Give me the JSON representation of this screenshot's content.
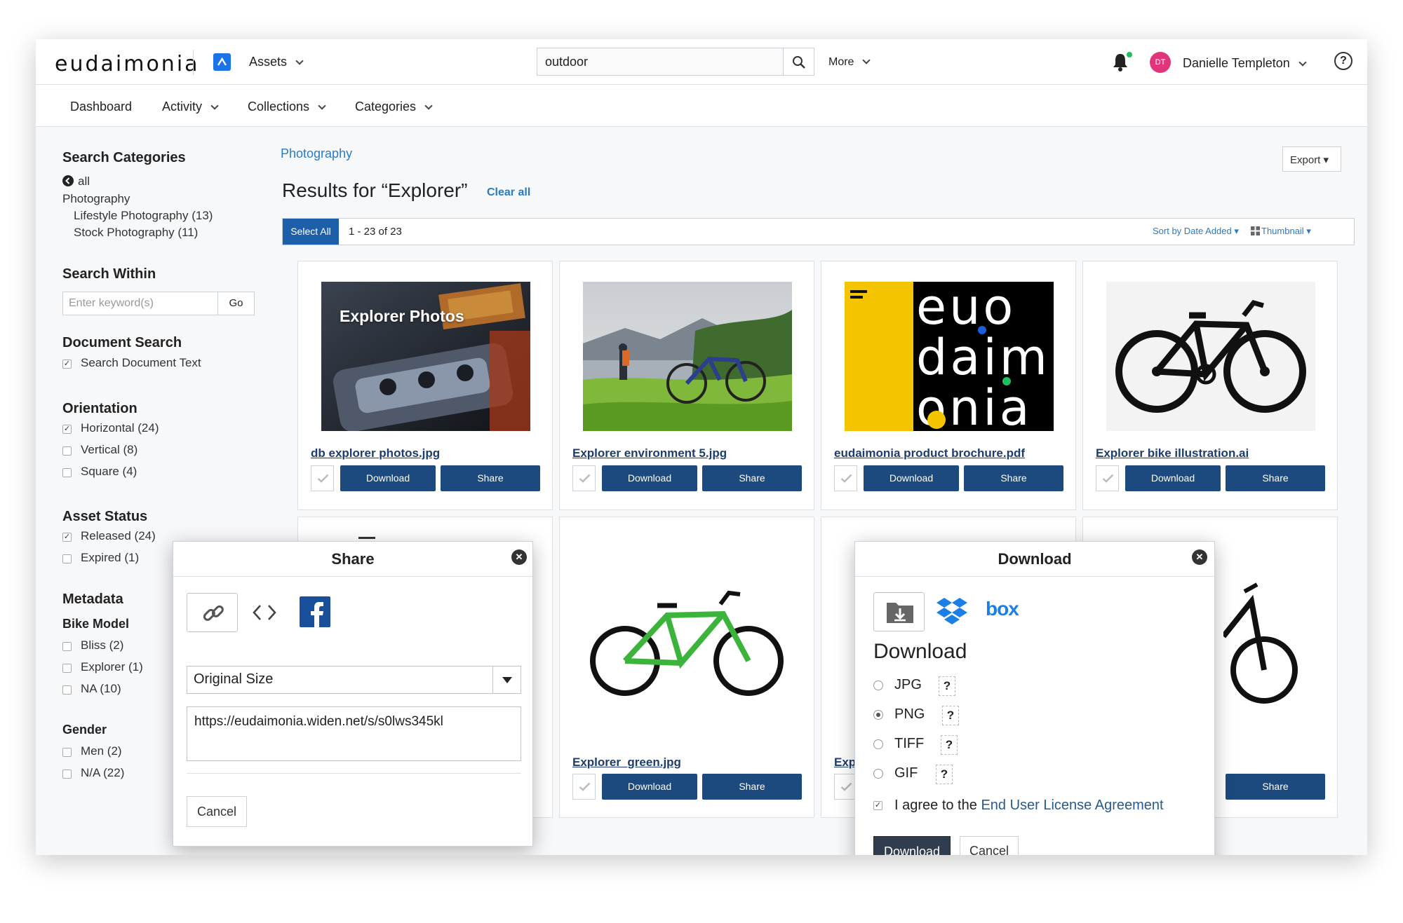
{
  "topbar": {
    "logo": "eudaimonia",
    "app_label": "Assets",
    "search_value": "outdoor",
    "more_label": "More",
    "user_initials": "DT",
    "user_name": "Danielle Templeton",
    "help_label": "?"
  },
  "nav": {
    "items": [
      "Dashboard",
      "Activity",
      "Collections",
      "Categories"
    ]
  },
  "sidebar": {
    "search_categories": {
      "heading": "Search Categories",
      "all": "all",
      "parent": "Photography",
      "children": [
        "Lifestyle Photography (13)",
        "Stock Photography (11)"
      ]
    },
    "search_within": {
      "heading": "Search Within",
      "placeholder": "Enter keyword(s)",
      "go": "Go"
    },
    "document_search": {
      "heading": "Document Search",
      "option": "Search Document Text"
    },
    "orientation": {
      "heading": "Orientation",
      "options": [
        "Horizontal (24)",
        "Vertical (8)",
        "Square (4)"
      ]
    },
    "asset_status": {
      "heading": "Asset Status",
      "options": [
        "Released (24)",
        "Expired (1)"
      ]
    },
    "metadata": {
      "heading": "Metadata",
      "bike_model": {
        "heading": "Bike Model",
        "options": [
          "Bliss (2)",
          "Explorer (1)",
          "NA (10)"
        ]
      },
      "gender": {
        "heading": "Gender",
        "options": [
          "Men (2)",
          "N/A (22)"
        ]
      }
    }
  },
  "main": {
    "breadcrumb": "Photography",
    "export_label": "Export",
    "results_title": "Results for “Explorer”",
    "clear_all": "Clear all",
    "select_all": "Select All",
    "count": "1 - 23 of 23",
    "sort_label": "Sort by Date Added",
    "view_label": "Thumbnail",
    "cards": [
      {
        "title": "db explorer photos.jpg",
        "overlay": "Explorer Photos",
        "download": "Download",
        "share": "Share"
      },
      {
        "title": "Explorer environment 5.jpg",
        "download": "Download",
        "share": "Share"
      },
      {
        "title": "eudaimonia product brochure.pdf",
        "brochure_text": [
          "euo",
          "daim",
          "onia"
        ],
        "download": "Download",
        "share": "Share"
      },
      {
        "title": "Explorer bike illustration.ai",
        "download": "Download",
        "share": "Share"
      },
      {
        "title": "Explorer_green.jpg",
        "download": "Download",
        "share": "Share"
      },
      {
        "title": "Expl",
        "share": "Share"
      }
    ]
  },
  "share_modal": {
    "title": "Share",
    "size_value": "Original Size",
    "link_value": "https://eudaimonia.widen.net/s/s0lws345kl",
    "cancel": "Cancel"
  },
  "download_modal": {
    "title": "Download",
    "box_label": "box",
    "heading": "Download",
    "formats": [
      {
        "label": "JPG",
        "selected": false
      },
      {
        "label": "PNG",
        "selected": true
      },
      {
        "label": "TIFF",
        "selected": false
      },
      {
        "label": "GIF",
        "selected": false
      }
    ],
    "help_label": "?",
    "agree_prefix": "I agree to the",
    "agree_link": "End User License Agreement",
    "download_btn": "Download",
    "cancel_btn": "Cancel"
  },
  "colors": {
    "primary_button": "#1c4a7e",
    "select_all": "#1d5fa8",
    "link": "#2a7bc0",
    "brochure_yellow": "#f5c400",
    "avatar": "#e0357a"
  }
}
